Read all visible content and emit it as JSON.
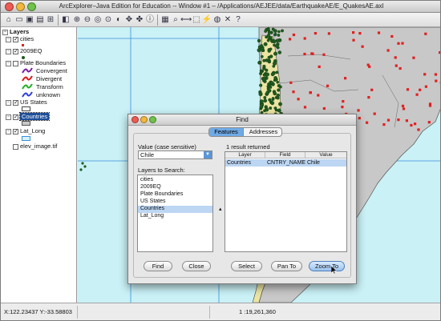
{
  "window": {
    "title": "ArcExplorer–Java Edition for Education -- Window #1 – /Applications/AEJEE/data/EarthquakeAE/E_QuakesAE.axl"
  },
  "toolbar": {
    "icons": [
      "new-icon",
      "open-icon",
      "save-icon",
      "print-icon",
      "add-layer-icon",
      "remove-layer-icon",
      "zoom-in-icon",
      "zoom-out-icon",
      "full-extent-icon",
      "zoom-active-icon",
      "zoom-previous-icon",
      "pan-icon",
      "pan-direction-icon",
      "identify-icon",
      "query-icon",
      "find-icon",
      "measure-icon",
      "select-icon",
      "hyperlink-icon",
      "buffer-icon",
      "clear-icon",
      "help-icon"
    ]
  },
  "toc": {
    "root_label": "Layers",
    "layers": [
      {
        "name": "cities",
        "checked": true
      },
      {
        "name": "2009EQ",
        "checked": true
      },
      {
        "name": "Plate Boundaries",
        "checked": false,
        "legend": [
          "Convergent",
          "Divergent",
          "Transform",
          "unknown"
        ]
      },
      {
        "name": "US States",
        "checked": true
      },
      {
        "name": "Countries",
        "checked": true,
        "selected": true
      },
      {
        "name": "Lat_Long",
        "checked": true
      },
      {
        "name": "elev_image.tif",
        "checked": false
      }
    ],
    "colors": {
      "convergent": "#7a1fa2",
      "divergent": "#e01818",
      "transform": "#22b022",
      "unknown": "#2f3fd8",
      "cities": "#e02020",
      "quake": "#1f5a1f",
      "countries_fill": "#c8c8c8",
      "lat_long": "#3a8fd8",
      "selection": "#1d4e9a"
    }
  },
  "status": {
    "coords": "X:122.23437 Y:-33.58803",
    "scale": "1 :19,261,360"
  },
  "find_dialog": {
    "title": "Find",
    "tabs": [
      "Features",
      "Addresses"
    ],
    "active_tab": "Features",
    "value_label": "Value (case sensitive)",
    "value": "Chile",
    "layers_label": "Layers to Search:",
    "layers": [
      "cities",
      "2009EQ",
      "Plate Boundaries",
      "US States",
      "Countries",
      "Lat_Long"
    ],
    "selected_layer": "Countries",
    "results_label": "1 result returned",
    "columns": [
      "Layer",
      "Field",
      "Value"
    ],
    "rows": [
      [
        "Countries",
        "CNTRY_NAME",
        "Chile"
      ]
    ],
    "buttons": {
      "find": "Find",
      "close": "Close",
      "select": "Select",
      "pan_to": "Pan To",
      "zoom_to": "Zoom To"
    }
  }
}
